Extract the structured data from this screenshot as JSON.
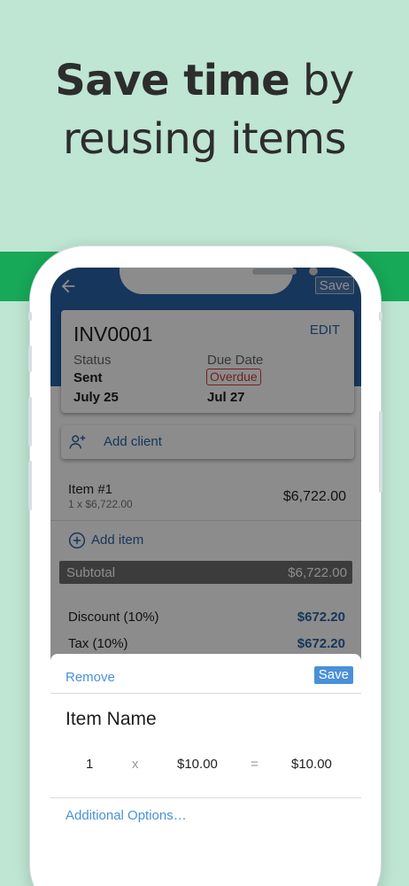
{
  "promo": {
    "headline_bold": "Save time",
    "headline_rest_line1": " by",
    "headline_line2": "reusing items"
  },
  "colors": {
    "background": "#bfe5d3",
    "band": "#17a858",
    "app_blue": "#2b63a6",
    "link_blue": "#4a90d9",
    "overdue_red": "#d23b3b"
  },
  "appbar": {
    "back_icon": "back-arrow-icon",
    "save_label": "Save"
  },
  "invoice": {
    "number": "INV0001",
    "edit_label": "EDIT",
    "status_label": "Status",
    "status_value": "Sent",
    "issue_date": "July 25",
    "due_label": "Due Date",
    "due_badge": "Overdue",
    "due_value": "Jul 27"
  },
  "client": {
    "icon": "add-person-icon",
    "label": "Add client"
  },
  "items": [
    {
      "name": "Item #1",
      "detail": "1 x $6,722.00",
      "amount": "$6,722.00"
    }
  ],
  "add_item": {
    "icon": "plus-circle-icon",
    "label": "Add item"
  },
  "totals": {
    "subtotal_label": "Subtotal",
    "subtotal_value": "$6,722.00",
    "discount_label": "Discount (10%)",
    "discount_value": "$672.20",
    "tax_label": "Tax (10%)",
    "tax_value": "$672.20"
  },
  "sheet": {
    "remove_label": "Remove",
    "save_label": "Save",
    "item_name": "Item Name",
    "quantity": "1",
    "times_sign": "x",
    "rate": "$10.00",
    "equals_sign": "=",
    "total": "$10.00",
    "more_options": "Additional Options…"
  }
}
